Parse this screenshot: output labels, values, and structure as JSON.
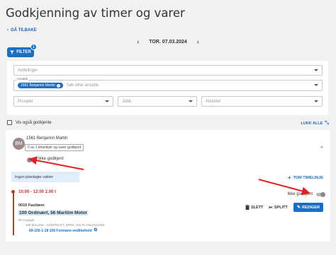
{
  "page": {
    "title": "Godkjenning av timer og varer",
    "back_label": "GÅ TILBAKE",
    "date": "TOR. 07.03.2024",
    "filter_label": "FILTER",
    "filter_count": "1"
  },
  "filters": {
    "department": {
      "placeholder": "Avdelinger"
    },
    "employee": {
      "label": "Ansatte",
      "chip": "1561 Benjamin Martin",
      "placeholder": "Søk etter ansatte"
    },
    "project": {
      "placeholder": "Prosjekt"
    },
    "job": {
      "placeholder": "Jobb"
    },
    "activity": {
      "placeholder": "Aktivitet"
    }
  },
  "options": {
    "show_approved": "Vis også godkjente",
    "collapse_all": "LUKK ALLE"
  },
  "employee_card": {
    "initials": "BM",
    "name": "1561 Benjamin Martin",
    "approval_status": "0 av 1 timelinjer og varer godkjent",
    "approve_toggle_label": "Ikke godkjent",
    "no_shifts": "Ingon planlagte vakter",
    "add_empty_line": "TOM TIMELINJE",
    "entry": {
      "time": "10:00 - 12:00 2.00 t",
      "approve_toggle_label": "Ikke godkjent",
      "wage_type": "0010 Fastlønn",
      "order": "100 Ordinært, 56 Maritim Motor",
      "voyage": "69 Voyager",
      "category": "100 MALING - KONTRAKT, SPES. OG PLANLEGGING",
      "work_order": "69-100-1-18 106 Formann vedlikehold",
      "delete_label": "SLETT",
      "split_label": "SPLITT",
      "edit_label": "REDIGER"
    }
  },
  "colors": {
    "primary": "#1a6fc2",
    "annotation_arrow": "#e02424",
    "entry_accent": "#c0392b"
  }
}
